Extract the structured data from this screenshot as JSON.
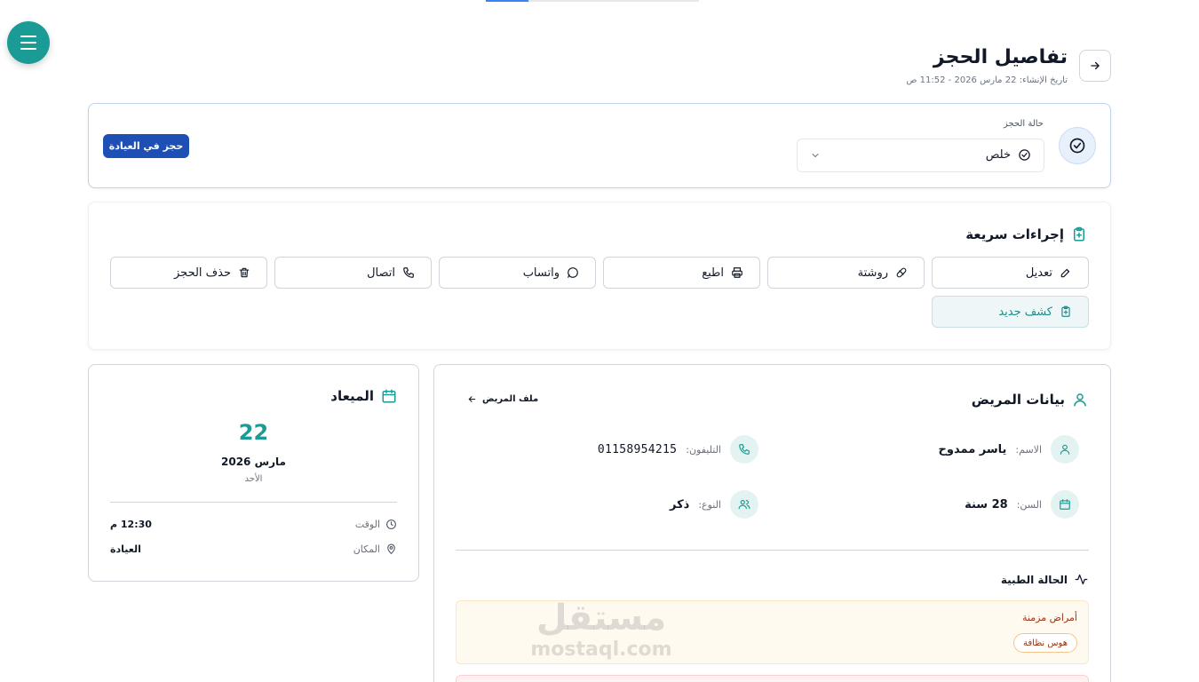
{
  "header": {
    "title": "تفاصيل الحجز",
    "created_at": "تاريخ الإنشاء: 22 مارس 2026 - 11:52 ص"
  },
  "status": {
    "label": "حالة الحجز",
    "selected": "خلص",
    "clinic_button": "حجز في العيادة"
  },
  "quick_actions": {
    "title": "إجراءات سريعة",
    "edit": "تعديل",
    "prescription": "روشتة",
    "print": "اطبع",
    "whatsapp": "واتساب",
    "call": "اتصال",
    "delete": "حذف الحجز",
    "new_exam": "كشف جديد"
  },
  "patient": {
    "title": "بيانات المريض",
    "file_link": "ملف المريض",
    "name_label": "الاسم:",
    "name": "ياسر ممدوح",
    "phone_label": "التليفون:",
    "phone": "01158954215",
    "age_label": "السن:",
    "age": "28 سنة",
    "gender_label": "النوع:",
    "gender": "ذكر",
    "medical_title": "الحالة الطبية",
    "chronic_label": "أمراض مزمنة",
    "chronic_tag": "هوس نظافة"
  },
  "appointment": {
    "title": "الميعاد",
    "day": "22",
    "month_year": "مارس 2026",
    "weekday": "الأحد",
    "time_label": "الوقت",
    "time": "12:30 م",
    "place_label": "المكان",
    "place": "العيادة"
  },
  "watermark": {
    "ar": "مستقل",
    "en": "mostaql.com"
  },
  "colors": {
    "primary": "#1a9b95",
    "clinic_button": "#1e4fb5"
  }
}
